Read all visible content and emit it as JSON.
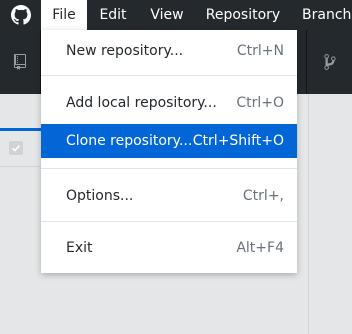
{
  "menubar": {
    "items": [
      {
        "label": "File",
        "active": true
      },
      {
        "label": "Edit"
      },
      {
        "label": "View"
      },
      {
        "label": "Repository"
      },
      {
        "label": "Branch"
      }
    ]
  },
  "file_menu": {
    "items": [
      {
        "label": "New repository...",
        "shortcut": "Ctrl+N"
      },
      {
        "label": "Add local repository...",
        "shortcut": "Ctrl+O"
      },
      {
        "label": "Clone repository...",
        "shortcut": "Ctrl+Shift+O",
        "selected": true
      },
      {
        "label": "Options...",
        "shortcut": "Ctrl+,"
      },
      {
        "label": "Exit",
        "shortcut": "Alt+F4"
      }
    ]
  },
  "colors": {
    "menubar_bg": "#24292e",
    "selection": "#0366d6",
    "overlay": "#e4e6e8"
  },
  "icons": {
    "app": "github-mark-icon",
    "toolbar_left": "repository-icon",
    "toolbar_right": "git-branch-icon",
    "checkbox": "checkmark-icon"
  }
}
